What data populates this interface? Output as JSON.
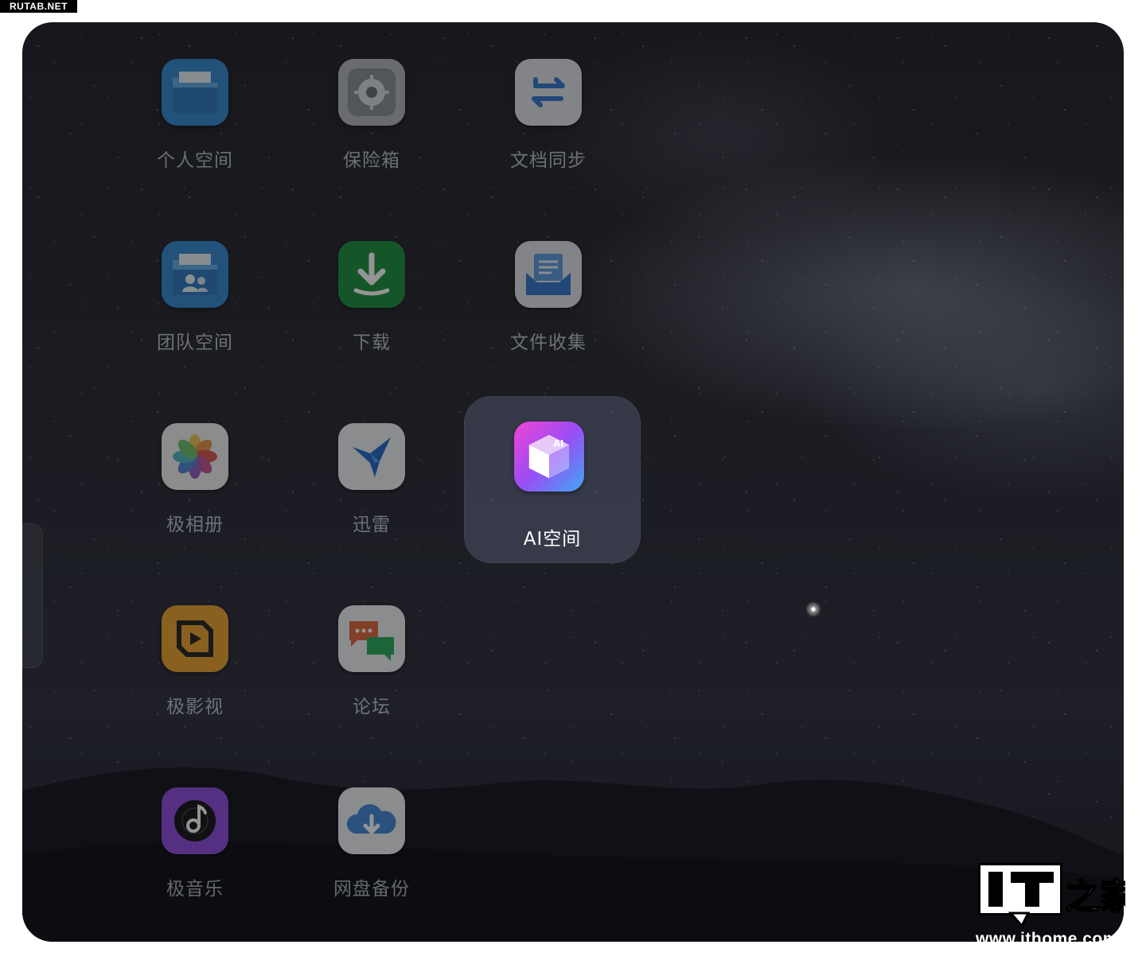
{
  "source_tag": "RUTAB.NET",
  "apps": [
    {
      "label": "个人空间",
      "icon": "folder-icon"
    },
    {
      "label": "保险箱",
      "icon": "safe-icon"
    },
    {
      "label": "文档同步",
      "icon": "sync-arrows-icon"
    },
    {
      "label": "团队空间",
      "icon": "team-folder-icon"
    },
    {
      "label": "下载",
      "icon": "download-icon"
    },
    {
      "label": "文件收集",
      "icon": "file-collect-icon"
    },
    {
      "label": "极相册",
      "icon": "photos-flower-icon"
    },
    {
      "label": "迅雷",
      "icon": "thunder-bird-icon"
    },
    {
      "label": "AI空间",
      "icon": "ai-cube-icon",
      "selected": true,
      "badge": "AI"
    },
    {
      "label": "极影视",
      "icon": "video-icon"
    },
    {
      "label": "论坛",
      "icon": "chat-bubbles-icon"
    },
    {
      "label": "极音乐",
      "icon": "music-disc-icon"
    },
    {
      "label": "网盘备份",
      "icon": "cloud-backup-icon"
    }
  ],
  "watermark": {
    "logo_text": "IT之家",
    "url": "www.ithome.com"
  },
  "colors": {
    "accent_ai": "#c24cf5",
    "download_green": "#169a3c",
    "folder_blue": "#2f8fe0"
  }
}
